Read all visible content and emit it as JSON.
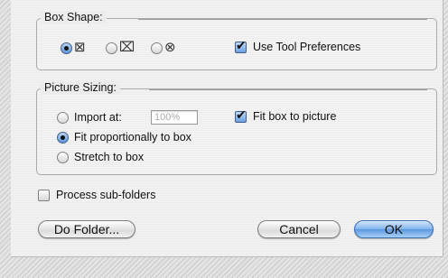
{
  "box_shape": {
    "legend": "Box Shape:",
    "options": [
      {
        "glyph": "⊠",
        "selected": true
      },
      {
        "glyph": "⌧",
        "selected": false
      },
      {
        "glyph": "⊗",
        "selected": false
      }
    ],
    "use_tool_prefs": {
      "label": "Use Tool Preferences",
      "checked": true
    }
  },
  "picture_sizing": {
    "legend": "Picture Sizing:",
    "import_at": {
      "label": "Import at:",
      "value": "100%",
      "selected": false
    },
    "fit_proportionally": {
      "label": "Fit proportionally to box",
      "selected": true
    },
    "stretch": {
      "label": "Stretch to box",
      "selected": false
    },
    "fit_box_to_picture": {
      "label": "Fit box to picture",
      "checked": true
    }
  },
  "process_subfolders": {
    "label": "Process sub-folders",
    "checked": false
  },
  "buttons": {
    "do_folder": "Do Folder...",
    "cancel": "Cancel",
    "ok": "OK"
  },
  "colors": {
    "accent": "#5a97df"
  }
}
